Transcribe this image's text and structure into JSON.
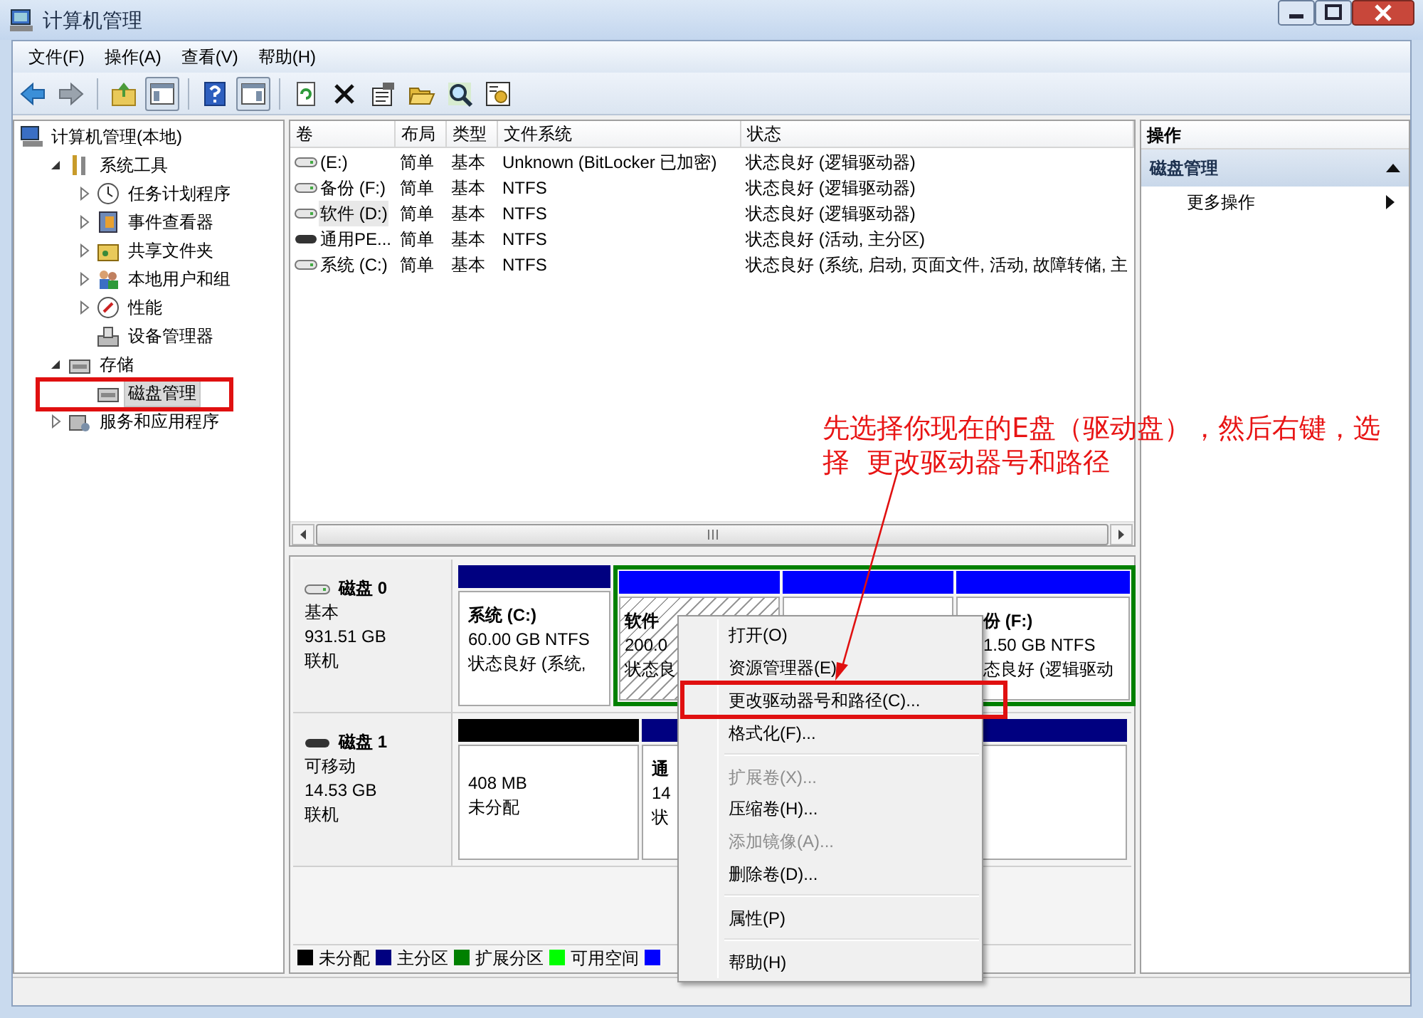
{
  "window": {
    "title": "计算机管理"
  },
  "menu_bar": [
    "文件(F)",
    "操作(A)",
    "查看(V)",
    "帮助(H)"
  ],
  "toolbar": [
    {
      "kind": "button",
      "pressed": false
    },
    {
      "kind": "button",
      "pressed": false
    },
    {
      "kind": "separator"
    },
    {
      "kind": "button",
      "pressed": false
    },
    {
      "kind": "button",
      "pressed": true
    },
    {
      "kind": "separator"
    },
    {
      "kind": "button",
      "pressed": false
    },
    {
      "kind": "button",
      "pressed": true
    },
    {
      "kind": "separator"
    },
    {
      "kind": "button",
      "pressed": false
    },
    {
      "kind": "button",
      "pressed": false
    },
    {
      "kind": "button",
      "pressed": false
    },
    {
      "kind": "button",
      "pressed": false
    },
    {
      "kind": "button",
      "pressed": false
    },
    {
      "kind": "button",
      "pressed": false
    }
  ],
  "tree": [
    {
      "kind": "root",
      "label": "计算机管理(本地)",
      "selected": false,
      "children": [
        {
          "kind": "branch",
          "label": "系统工具",
          "expanded": true,
          "selected": false,
          "children": [
            {
              "kind": "branch",
              "label": "任务计划程序",
              "expanded": false,
              "selected": false
            },
            {
              "kind": "branch",
              "label": "事件查看器",
              "expanded": false,
              "selected": false
            },
            {
              "kind": "branch",
              "label": "共享文件夹",
              "expanded": false,
              "selected": false
            },
            {
              "kind": "branch",
              "label": "本地用户和组",
              "expanded": false,
              "selected": false
            },
            {
              "kind": "branch",
              "label": "性能",
              "expanded": false,
              "selected": false
            },
            {
              "kind": "leaf",
              "label": "设备管理器",
              "selected": false
            }
          ]
        },
        {
          "kind": "branch",
          "label": "存储",
          "expanded": true,
          "selected": false,
          "children": [
            {
              "kind": "leaf",
              "label": "磁盘管理",
              "selected": true
            }
          ]
        },
        {
          "kind": "branch",
          "label": "服务和应用程序",
          "expanded": false,
          "selected": false
        }
      ]
    }
  ],
  "volume_table": {
    "columns": [
      "卷",
      "布局",
      "类型",
      "文件系统",
      "状态"
    ],
    "rows": [
      {
        "kind": "hdd",
        "selected": false,
        "cells": [
          "(E:)",
          "简单",
          "基本",
          "Unknown (BitLocker 已加密)",
          "状态良好 (逻辑驱动器)"
        ]
      },
      {
        "kind": "hdd",
        "selected": false,
        "cells": [
          "备份 (F:)",
          "简单",
          "基本",
          "NTFS",
          "状态良好 (逻辑驱动器)"
        ]
      },
      {
        "kind": "hdd",
        "selected": true,
        "cells": [
          "软件 (D:)",
          "简单",
          "基本",
          "NTFS",
          "状态良好 (逻辑驱动器)"
        ]
      },
      {
        "kind": "removable",
        "selected": false,
        "cells": [
          "通用PE...",
          "简单",
          "基本",
          "NTFS",
          "状态良好 (活动, 主分区)"
        ]
      },
      {
        "kind": "hdd",
        "selected": false,
        "cells": [
          "系统 (C:)",
          "简单",
          "基本",
          "NTFS",
          "状态良好 (系统, 启动, 页面文件, 活动, 故障转储, 主"
        ]
      }
    ]
  },
  "disks": [
    {
      "kind": "hdd",
      "name": "磁盘 0",
      "lines": [
        "基本",
        "931.51 GB",
        "联机"
      ],
      "partitions": [
        {
          "kind": "primary",
          "selected": false,
          "title": "系统 (C:)",
          "lines": [
            "60.00 GB NTFS",
            "状态良好 (系统,"
          ]
        },
        {
          "kind": "extended",
          "children": [
            {
              "kind": "logical",
              "selected": true,
              "title": "软件",
              "lines": [
                "200.0",
                "状态良"
              ]
            },
            {
              "kind": "logical",
              "selected": false
            },
            {
              "kind": "logical",
              "selected": false,
              "title": "份 (F:)",
              "lines": [
                "1.50 GB NTFS",
                "态良好 (逻辑驱动"
              ]
            }
          ]
        }
      ]
    },
    {
      "kind": "removable",
      "name": "磁盘 1",
      "lines": [
        "可移动",
        "14.53 GB",
        "联机"
      ],
      "partitions": [
        {
          "kind": "unallocated",
          "selected": false,
          "lines": [
            "408 MB",
            "未分配"
          ]
        },
        {
          "kind": "primary",
          "selected": false,
          "title": "通",
          "lines": [
            "14",
            "状"
          ]
        }
      ]
    }
  ],
  "legend": [
    {
      "label": "未分配",
      "color": "#000000"
    },
    {
      "label": "主分区",
      "color": "#000080"
    },
    {
      "label": "扩展分区",
      "color": "#008000"
    },
    {
      "label": "可用空间",
      "color": "#00ff00"
    },
    {
      "color": "#0000ff"
    }
  ],
  "actions": {
    "title": "操作",
    "section": "磁盘管理",
    "expanded": true,
    "items": [
      "更多操作"
    ]
  },
  "context_menu": [
    {
      "kind": "item",
      "label": "打开(O)",
      "disabled": false
    },
    {
      "kind": "item",
      "label": "资源管理器(E)",
      "disabled": false
    },
    {
      "kind": "item",
      "label": "更改驱动器号和路径(C)...",
      "disabled": false
    },
    {
      "kind": "item",
      "label": "格式化(F)...",
      "disabled": false
    },
    {
      "kind": "separator"
    },
    {
      "kind": "item",
      "label": "扩展卷(X)...",
      "disabled": true
    },
    {
      "kind": "item",
      "label": "压缩卷(H)...",
      "disabled": false
    },
    {
      "kind": "item",
      "label": "添加镜像(A)...",
      "disabled": true
    },
    {
      "kind": "item",
      "label": "删除卷(D)...",
      "disabled": false
    },
    {
      "kind": "separator"
    },
    {
      "kind": "item",
      "label": "属性(P)",
      "disabled": false
    },
    {
      "kind": "separator"
    },
    {
      "kind": "item",
      "label": "帮助(H)",
      "disabled": false
    }
  ],
  "annotation": "先选择你现在的E盘（驱动盘），然后右键，选择  更改驱动器号和路径"
}
